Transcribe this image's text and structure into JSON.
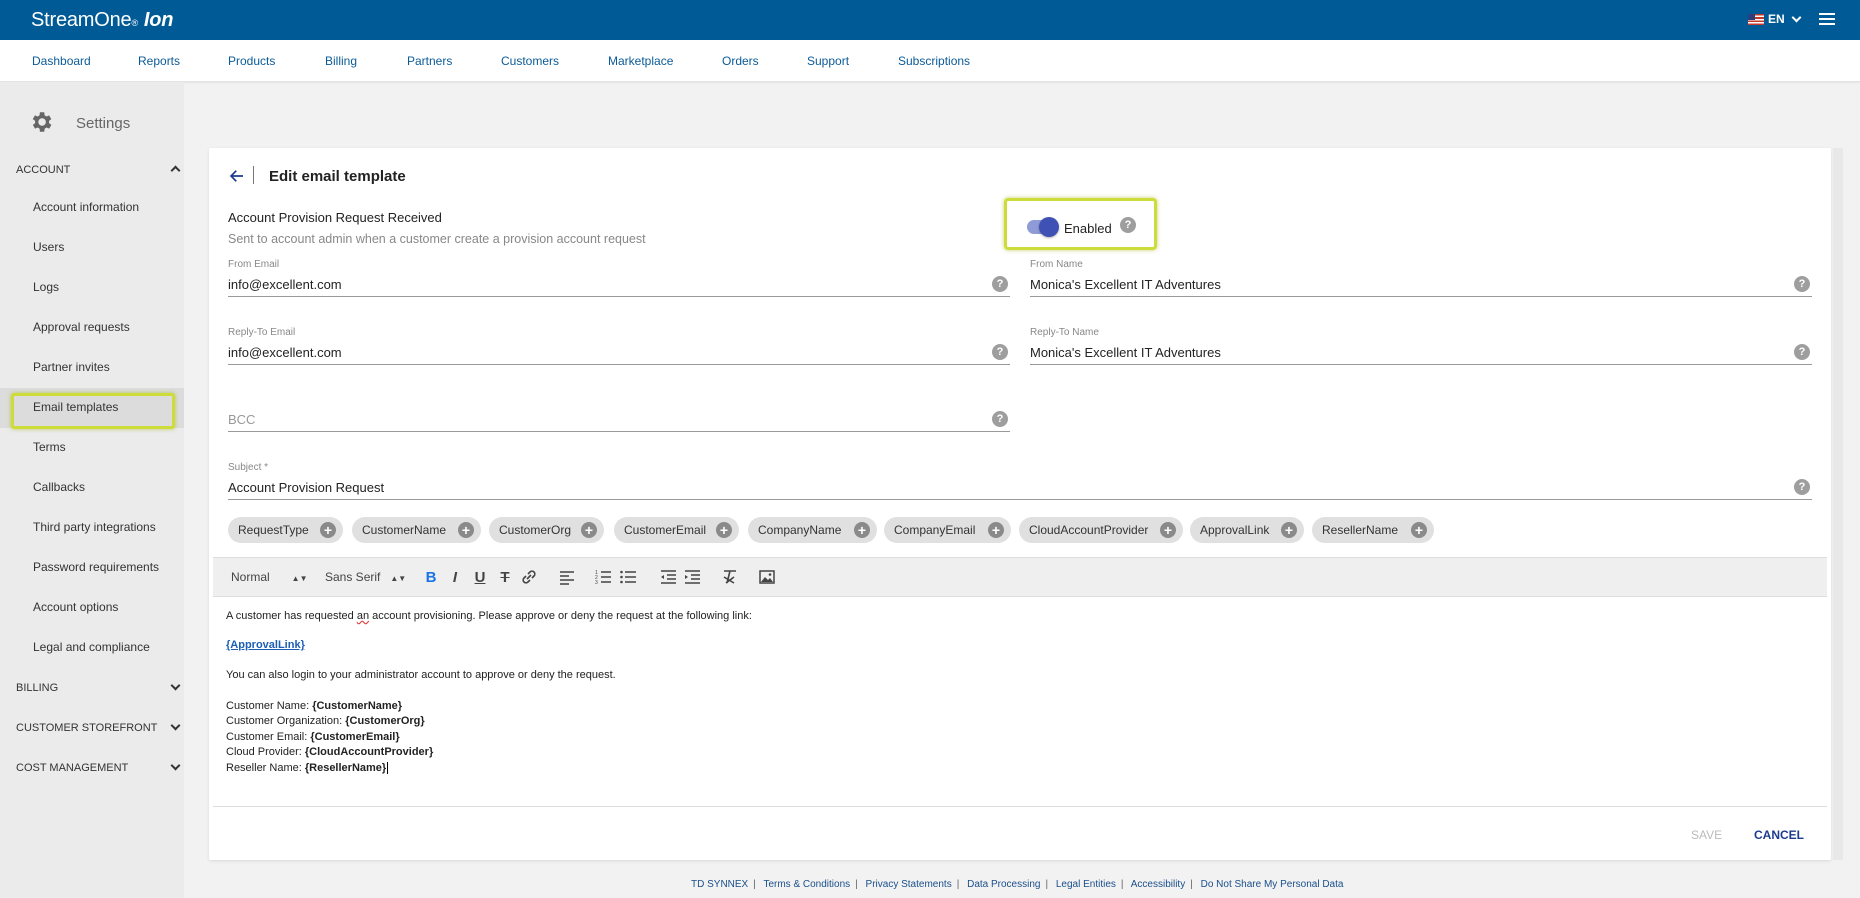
{
  "brand": {
    "name": "StreamOne",
    "reg": "®",
    "suffix": "Ion"
  },
  "header": {
    "language": "EN"
  },
  "nav": [
    "Dashboard",
    "Reports",
    "Products",
    "Billing",
    "Partners",
    "Customers",
    "Marketplace",
    "Orders",
    "Support",
    "Subscriptions"
  ],
  "sidebar": {
    "title": "Settings",
    "account_section": "ACCOUNT",
    "items": [
      "Account information",
      "Users",
      "Logs",
      "Approval requests",
      "Partner invites",
      "Email templates",
      "Terms",
      "Callbacks",
      "Third party integrations",
      "Password requirements",
      "Account options",
      "Legal and compliance"
    ],
    "sections": [
      "BILLING",
      "CUSTOMER STOREFRONT",
      "COST MANAGEMENT"
    ]
  },
  "page": {
    "title": "Edit email template",
    "template_name": "Account Provision Request Received",
    "template_desc": "Sent to account admin when a customer create a provision account request",
    "toggle_label": "Enabled",
    "help": "?"
  },
  "form": {
    "from_email_label": "From Email",
    "from_email": "info@excellent.com",
    "from_name_label": "From Name",
    "from_name": "Monica's Excellent IT Adventures",
    "reply_email_label": "Reply-To Email",
    "reply_email": "info@excellent.com",
    "reply_name_label": "Reply-To Name",
    "reply_name": "Monica's Excellent IT Adventures",
    "bcc_placeholder": "BCC",
    "subject_label": "Subject *",
    "subject": "Account Provision Request"
  },
  "chips": [
    "RequestType",
    "CustomerName",
    "CustomerOrg",
    "CustomerEmail",
    "CompanyName",
    "CompanyEmail",
    "CloudAccountProvider",
    "ApprovalLink",
    "ResellerName"
  ],
  "toolbar": {
    "format": "Normal",
    "font": "Sans Serif"
  },
  "editor": {
    "line1_a": "A customer has requested ",
    "line1_b": "an",
    "line1_c": " account provisioning. Please approve or deny the request at the following link:",
    "link": "{ApprovalLink}",
    "line3": "You can also login to your administrator account to approve or deny the request.",
    "rows": [
      {
        "label": "Customer Name: ",
        "value": "{CustomerName}"
      },
      {
        "label": "Customer Organization: ",
        "value": "{CustomerOrg}"
      },
      {
        "label": "Customer Email: ",
        "value": "{CustomerEmail}"
      },
      {
        "label": "Cloud Provider: ",
        "value": "{CloudAccountProvider}"
      },
      {
        "label": "Reseller Name: ",
        "value": "{ResellerName}"
      }
    ]
  },
  "actions": {
    "save": "SAVE",
    "cancel": "CANCEL"
  },
  "footer": [
    "TD SYNNEX",
    "Terms & Conditions",
    "Privacy Statements",
    "Data Processing",
    "Legal Entities",
    "Accessibility",
    "Do Not Share My Personal Data"
  ],
  "colors": {
    "topbar": "#005a96",
    "highlight": "#cddc39",
    "toggle": "#3f51b5",
    "nav_link": "#0b5b98"
  }
}
